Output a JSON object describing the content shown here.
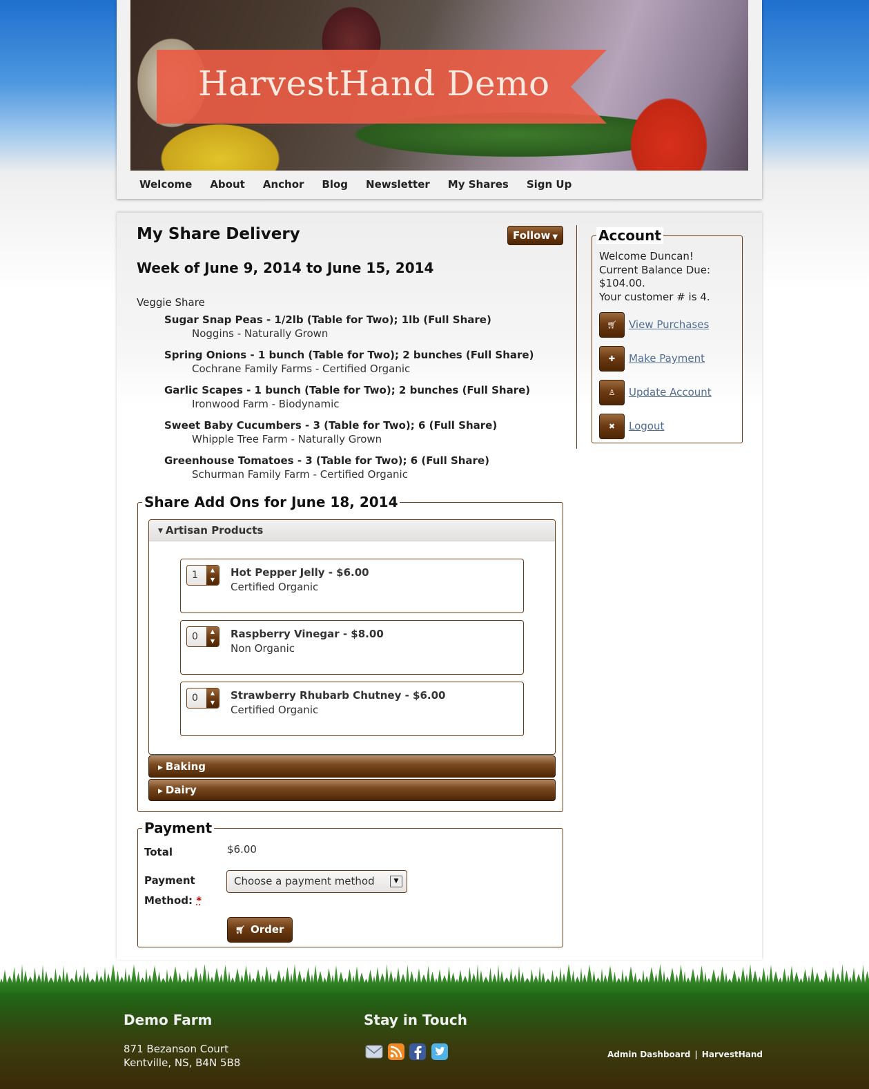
{
  "site": {
    "title": "HarvestHand Demo"
  },
  "nav": {
    "items": [
      "Welcome",
      "About",
      "Anchor",
      "Blog",
      "Newsletter",
      "My Shares",
      "Sign Up"
    ]
  },
  "main": {
    "page_title": "My Share Delivery",
    "follow_label": "Follow",
    "week_title": "Week of June 9, 2014 to June 15, 2014",
    "share_type": "Veggie Share",
    "vegetables": [
      {
        "name": "Sugar Snap Peas - 1/2lb (Table for Two); 1lb (Full Share)",
        "farm": "Noggins - Naturally Grown"
      },
      {
        "name": "Spring Onions - 1 bunch (Table for Two); 2 bunches (Full Share)",
        "farm": "Cochrane Family Farms - Certified Organic"
      },
      {
        "name": "Garlic Scapes - 1 bunch (Table for Two); 2 bunches (Full Share)",
        "farm": "Ironwood Farm - Biodynamic"
      },
      {
        "name": "Sweet Baby Cucumbers - 3 (Table for Two); 6 (Full Share)",
        "farm": "Whipple Tree Farm - Naturally Grown"
      },
      {
        "name": "Greenhouse Tomatoes - 3 (Table for Two); 6 (Full Share)",
        "farm": "Schurman Family Farm - Certified Organic"
      }
    ]
  },
  "addons": {
    "legend": "Share Add Ons for June 18, 2014",
    "open_section": "Artisan Products",
    "products": [
      {
        "qty": "1",
        "name": "Hot Pepper Jelly - $6.00",
        "cert": "Certified Organic"
      },
      {
        "qty": "0",
        "name": "Raspberry Vinegar - $8.00",
        "cert": "Non Organic"
      },
      {
        "qty": "0",
        "name": "Strawberry Rhubarb Chutney - $6.00",
        "cert": "Certified Organic"
      }
    ],
    "closed_sections": [
      "Baking",
      "Dairy"
    ]
  },
  "payment": {
    "legend": "Payment",
    "total_label": "Total",
    "total_value": "$6.00",
    "method_label_1": "Payment",
    "method_label_2": "Method:",
    "required_mark": "*",
    "select_placeholder": "Choose a payment method",
    "order_label": "Order"
  },
  "account": {
    "legend": "Account",
    "welcome": "Welcome Duncan!",
    "balance_label": "Current Balance Due:",
    "balance_value": "$104.00.",
    "customer_line": "Your customer # is 4.",
    "links": [
      "View Purchases",
      "Make Payment",
      "Update Account",
      "Logout"
    ],
    "link_icons": [
      "cart-icon",
      "plus-icon",
      "user-icon",
      "close-icon"
    ]
  },
  "footer": {
    "farm_name": "Demo Farm",
    "address_line1": "871 Bezanson Court",
    "address_line2": "Kentville, NS, B4N 5B8",
    "stay_title": "Stay in Touch",
    "social_icons": [
      "email-icon",
      "rss-icon",
      "facebook-icon",
      "twitter-icon"
    ],
    "links": [
      "Admin Dashboard",
      "HarvestHand"
    ],
    "separator": "|"
  },
  "colors": {
    "brand_brown": "#6e3b12",
    "ribbon": "#e85c44",
    "link": "#4f6c95"
  }
}
